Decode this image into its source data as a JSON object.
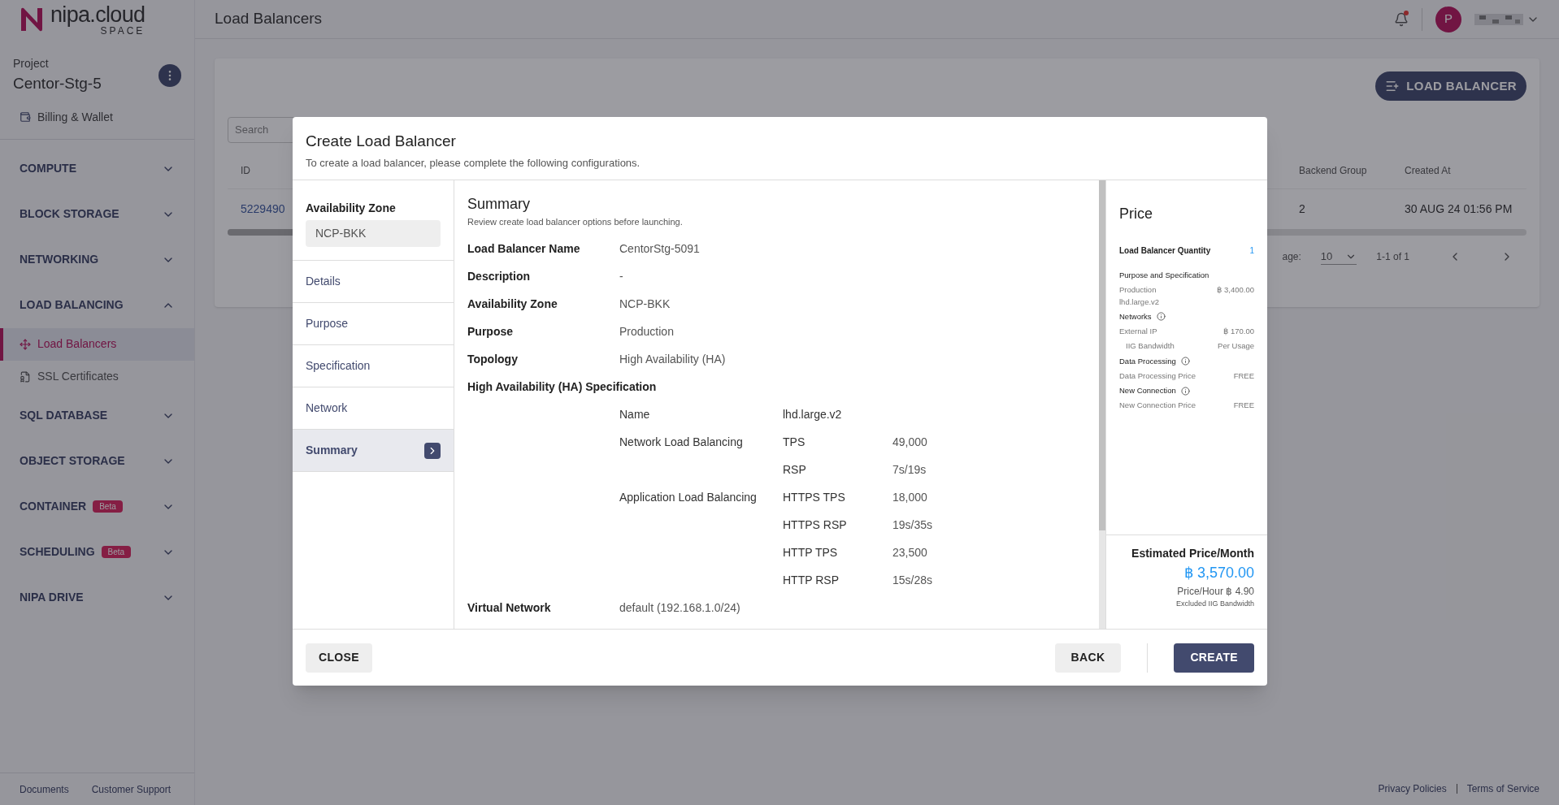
{
  "brand": {
    "name": "nipa.cloud",
    "sub": "SPACE"
  },
  "sidebar": {
    "project_label": "Project",
    "project_name": "Centor-Stg-5",
    "billing": "Billing & Wallet",
    "sections": [
      {
        "label": "COMPUTE",
        "expanded": false
      },
      {
        "label": "BLOCK STORAGE",
        "expanded": false
      },
      {
        "label": "NETWORKING",
        "expanded": false
      },
      {
        "label": "LOAD BALANCING",
        "expanded": true,
        "children": [
          {
            "label": "Load Balancers",
            "selected": true
          },
          {
            "label": "SSL Certificates",
            "selected": false
          }
        ]
      },
      {
        "label": "SQL DATABASE",
        "expanded": false
      },
      {
        "label": "OBJECT STORAGE",
        "expanded": false
      },
      {
        "label": "CONTAINER",
        "expanded": false,
        "badge": "Beta"
      },
      {
        "label": "SCHEDULING",
        "expanded": false,
        "badge": "Beta"
      },
      {
        "label": "NIPA DRIVE",
        "expanded": false
      }
    ],
    "footer_links": [
      "Documents",
      "Customer Support"
    ]
  },
  "header": {
    "title": "Load Balancers",
    "avatar": "P",
    "notification": true
  },
  "page": {
    "create_button": "LOAD BALANCER",
    "search": {
      "placeholder": "Search"
    },
    "columns": [
      "ID",
      "Backend Group",
      "Created At"
    ],
    "rows": [
      {
        "id": "5229490",
        "backend_group": "2",
        "created_at": "30 AUG 24 01:56 PM"
      }
    ],
    "pagination": {
      "label": "age:",
      "per_page": "10",
      "range": "1-1 of 1"
    }
  },
  "footer_links": [
    "Privacy Policies",
    "Terms of Service"
  ],
  "modal": {
    "title": "Create Load Balancer",
    "subtitle": "To create a load balancer, please complete the following configurations.",
    "zone_label": "Availability Zone",
    "zone_value": "NCP-BKK",
    "steps": [
      {
        "label": "Details",
        "selected": false
      },
      {
        "label": "Purpose",
        "selected": false
      },
      {
        "label": "Specification",
        "selected": false
      },
      {
        "label": "Network",
        "selected": false
      },
      {
        "label": "Summary",
        "selected": true
      }
    ],
    "summary": {
      "title": "Summary",
      "subtitle": "Review create load balancer options before launching.",
      "fields": [
        {
          "label": "Load Balancer Name",
          "value": "CentorStg-5091"
        },
        {
          "label": "Description",
          "value": "-"
        },
        {
          "label": "Availability Zone",
          "value": "NCP-BKK"
        },
        {
          "label": "Purpose",
          "value": "Production"
        },
        {
          "label": "Topology",
          "value": "High Availability (HA)"
        }
      ],
      "spec_title": "High Availability (HA) Specification",
      "spec_rows": [
        {
          "label": "Name",
          "metric": "lhd.large.v2"
        },
        {
          "label": "Network Load Balancing",
          "metric": "TPS",
          "value": "49,000"
        },
        {
          "metric": "RSP",
          "value": "7s/19s"
        },
        {
          "label": "Application Load Balancing",
          "metric": "HTTPS TPS",
          "value": "18,000"
        },
        {
          "metric": "HTTPS RSP",
          "value": "19s/35s"
        },
        {
          "metric": "HTTP TPS",
          "value": "23,500"
        },
        {
          "metric": "HTTP RSP",
          "value": "15s/28s"
        }
      ],
      "after_fields": [
        {
          "label": "Virtual Network",
          "value": "default (192.168.1.0/24)"
        }
      ]
    },
    "price": {
      "title": "Price",
      "quantity_label": "Load Balancer Quantity",
      "quantity": "1",
      "groups": [
        {
          "title": "Purpose and Specification",
          "info": false,
          "items": [
            {
              "label": "Production",
              "sub": "lhd.large.v2",
              "value": "฿ 3,400.00",
              "indented": false
            }
          ]
        },
        {
          "title": "Networks",
          "info": true,
          "items": [
            {
              "label": "External IP",
              "value": "฿ 170.00",
              "indented": false
            },
            {
              "label": "IIG Bandwidth",
              "value": "Per Usage",
              "indented": true
            }
          ]
        },
        {
          "title": "Data Processing",
          "info": true,
          "items": [
            {
              "label": "Data Processing Price",
              "value": "FREE",
              "indented": false
            }
          ]
        },
        {
          "title": "New Connection",
          "info": true,
          "items": [
            {
              "label": "New Connection Price",
              "value": "FREE",
              "indented": false
            }
          ]
        }
      ],
      "estimate_label": "Estimated Price/Month",
      "estimate": "฿ 3,570.00",
      "per_hour": "Price/Hour ฿ 4.90",
      "note": "Excluded IIG Bandwidth"
    },
    "buttons": {
      "close": "CLOSE",
      "back": "BACK",
      "create": "CREATE"
    }
  }
}
